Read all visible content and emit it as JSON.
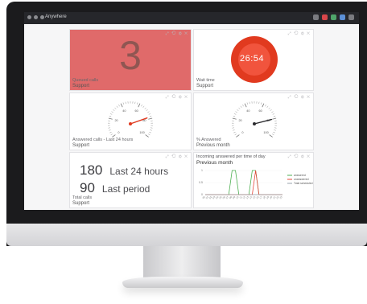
{
  "browser": {
    "tab_title": "Anywhere"
  },
  "tiles": {
    "calls_tile": {
      "value": "3",
      "caption_line1": "Queued calls",
      "caption_line2": "Support",
      "tools": "⤢ ⟲ ⚙ ✕"
    },
    "wait_tile": {
      "value": "26:54",
      "caption_line1": "Wait time",
      "caption_line2": "Support",
      "tools": "⤢ ⟲ ⚙ ✕"
    },
    "answered_gauge_tile": {
      "caption_line1": "Answered calls - Last 24 hours",
      "caption_line2": "Support",
      "tools": "⤢ ⟲ ⚙ ✕",
      "tick_labels": [
        "0",
        "20",
        "40",
        "60",
        "80",
        "100"
      ],
      "level": 0.78
    },
    "percent_gauge_tile": {
      "caption_line1": "% Answered",
      "caption_line2": "Previous month",
      "tools": "⤢ ⟲ ⚙ ✕",
      "tick_labels": [
        "0",
        "20",
        "40",
        "60",
        "80",
        "100"
      ],
      "level": 0.8
    },
    "totals_tile": {
      "row1_value": "180",
      "row1_label": "Last 24 hours",
      "row2_value": "90",
      "row2_label": "Last period",
      "caption_line1": "Total calls",
      "caption_line2": "Support",
      "tools": "⤢ ⟲ ⚙ ✕"
    },
    "chart_tile": {
      "title_line1": "Incoming answered per time of day",
      "title_line2": "Previous month",
      "tools": "⤢ ⟲ ⚙ ✕"
    }
  },
  "colors": {
    "calls_bg": "#e06a6a",
    "timer_red": "#e13a1f",
    "gauge_needle_red": "#e0391f",
    "gauge_needle_dark": "#2b2b2e",
    "answered_series": "#4caf50",
    "unanswered_series": "#e5473a"
  },
  "chart_data": {
    "type": "line",
    "title": "Incoming answered per time of day",
    "subtitle": "Previous month",
    "x": [
      "00",
      "01",
      "02",
      "03",
      "04",
      "05",
      "06",
      "07",
      "08",
      "09",
      "10",
      "11",
      "12",
      "13",
      "14",
      "15",
      "16",
      "17",
      "18",
      "19",
      "20",
      "21",
      "22",
      "23"
    ],
    "ylim": [
      0,
      1
    ],
    "series": [
      {
        "name": "answered",
        "color": "#4caf50",
        "values": [
          0,
          0,
          0,
          0,
          0,
          0,
          0,
          0,
          1,
          1,
          0,
          0,
          0,
          0,
          1,
          1,
          0,
          0,
          0,
          0,
          0,
          0,
          0,
          0
        ]
      },
      {
        "name": "unanswered",
        "color": "#e5473a",
        "values": [
          0,
          0,
          0,
          0,
          0,
          0,
          0,
          0,
          0,
          0,
          0,
          0,
          0,
          0,
          0,
          1,
          0,
          0,
          0,
          0,
          0,
          0,
          0,
          0
        ]
      },
      {
        "name": "Total scheduled",
        "color": "#9aa3ad",
        "values": [
          0,
          0,
          0,
          0,
          0,
          0,
          0,
          0,
          0,
          0,
          0,
          0,
          0,
          0,
          0,
          0,
          0,
          0,
          0,
          0,
          0,
          0,
          0,
          0
        ]
      }
    ]
  }
}
